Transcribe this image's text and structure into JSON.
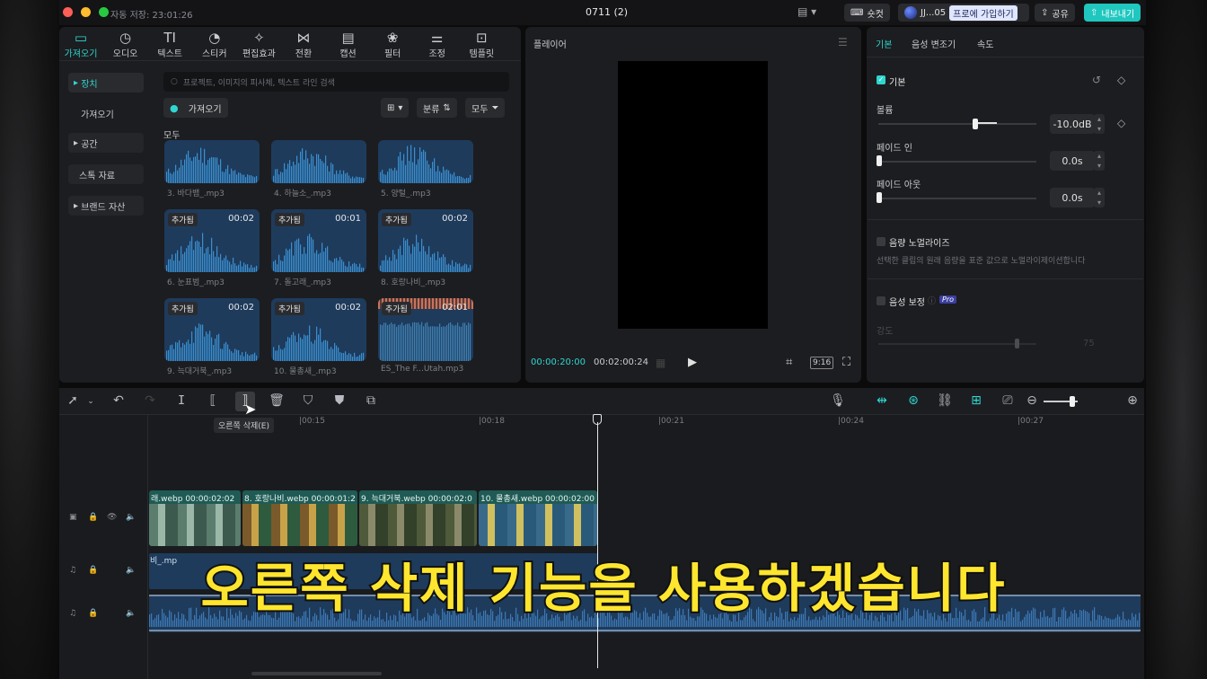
{
  "titlebar": {
    "autosave": "자동 저장: 23:01:26",
    "title": "0711 (2)",
    "shortcut_label": "숏컷",
    "user": "JJ...05",
    "pro_label": "프로에 가입하기",
    "share_label": "공유",
    "export_label": "내보내기"
  },
  "media_tabs": [
    {
      "icon": "import-icon",
      "label": "가져오기"
    },
    {
      "icon": "audio-icon",
      "label": "오디오"
    },
    {
      "icon": "text-icon",
      "label": "텍스트"
    },
    {
      "icon": "sticker-icon",
      "label": "스티커"
    },
    {
      "icon": "effects-icon",
      "label": "편집효과"
    },
    {
      "icon": "transition-icon",
      "label": "전환"
    },
    {
      "icon": "caption-icon",
      "label": "캡션"
    },
    {
      "icon": "filter-icon",
      "label": "필터"
    },
    {
      "icon": "adjust-icon",
      "label": "조정"
    },
    {
      "icon": "template-icon",
      "label": "템플릿"
    }
  ],
  "media_sidebar": [
    {
      "label": "장치"
    },
    {
      "label": "가져오기"
    },
    {
      "label": "공간"
    },
    {
      "label": "스톡 자료"
    },
    {
      "label": "브랜드 자산"
    }
  ],
  "media": {
    "search_placeholder": "프로젝트, 이미지의 피사체, 텍스트 라인 검색",
    "import_label": "가져오기",
    "sort_label": "분류",
    "filter_label": "모두",
    "section_label": "모두",
    "items": [
      {
        "name": "3. 바다뱀_.mp3",
        "badge": "",
        "duration": ""
      },
      {
        "name": "4. 하늘소_.mp3",
        "badge": "",
        "duration": ""
      },
      {
        "name": "5. 양털_.mp3",
        "badge": "",
        "duration": ""
      },
      {
        "name": "6. 눈표범_.mp3",
        "badge": "추가됨",
        "duration": "00:02"
      },
      {
        "name": "7. 돌고래_.mp3",
        "badge": "추가됨",
        "duration": "00:01"
      },
      {
        "name": "8. 호랑나비_.mp3",
        "badge": "추가됨",
        "duration": "00:02"
      },
      {
        "name": "9. 늑대거북_.mp3",
        "badge": "추가됨",
        "duration": "00:02"
      },
      {
        "name": "10. 물총새_.mp3",
        "badge": "추가됨",
        "duration": "00:02"
      },
      {
        "name": "ES_The F...Utah.mp3",
        "badge": "추가됨",
        "duration": "02:01"
      }
    ]
  },
  "player": {
    "title": "플레이어",
    "current_time": "00:00:20:00",
    "total_time": "00:02:00:24",
    "ratio": "9:16"
  },
  "inspector": {
    "tabs": [
      "기본",
      "음성 변조기",
      "속도"
    ],
    "section_basic": "기본",
    "volume_label": "볼륨",
    "volume_value": "-10.0dB",
    "fade_in_label": "페이드 인",
    "fade_in_value": "0.0s",
    "fade_out_label": "페이드 아웃",
    "fade_out_value": "0.0s",
    "normalize_label": "음량 노멀라이즈",
    "normalize_desc": "선택한 클립의 원래 음량을 표준 값으로 노멀라이제이션합니다",
    "enhance_label": "음성 보정",
    "pro_badge": "Pro",
    "strength_label": "강도",
    "strength_value": "75"
  },
  "timeline": {
    "tooltip": "오른쪽 삭제(E)",
    "ruler": [
      "|00:15",
      "|00:18",
      "|00:21",
      "|00:24",
      "|00:27"
    ],
    "clips": [
      {
        "label": "래.webp  00:00:02:02"
      },
      {
        "label": "8. 호랑나비.webp  00:00:01:2"
      },
      {
        "label": "9. 늑대거북.webp  00:00:02:0"
      },
      {
        "label": "10. 물총새.webp  00:00:02:00"
      }
    ],
    "audio_clip_label": "비_.mp"
  },
  "overlay_subtitle": "오른쪽 삭제 기능을 사용하겠습니다",
  "colors": {
    "accent": "#2fd6d0",
    "clip_video": "#1f5b54",
    "clip_audio": "#1e3b5c",
    "subtitle": "#ffe62e"
  }
}
